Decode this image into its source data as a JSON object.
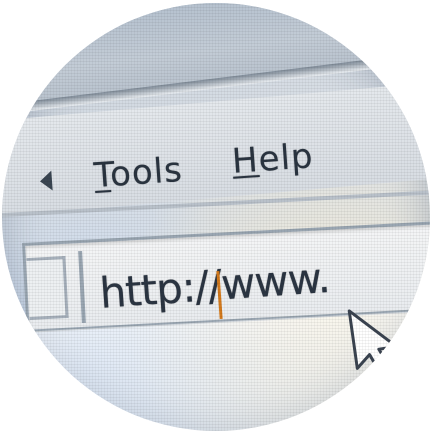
{
  "menu": {
    "items": [
      {
        "label": "Tools",
        "mnemonic": "T"
      },
      {
        "label": "Help",
        "mnemonic": "H"
      }
    ]
  },
  "address_bar": {
    "value": "http://www."
  },
  "colors": {
    "caret": "#d47a1c",
    "text": "#2b3542",
    "menubar": "#d8dde3",
    "titlebar": "#aebccb"
  },
  "icons": [
    "back-arrow-icon",
    "page-icon",
    "mouse-cursor-icon"
  ]
}
